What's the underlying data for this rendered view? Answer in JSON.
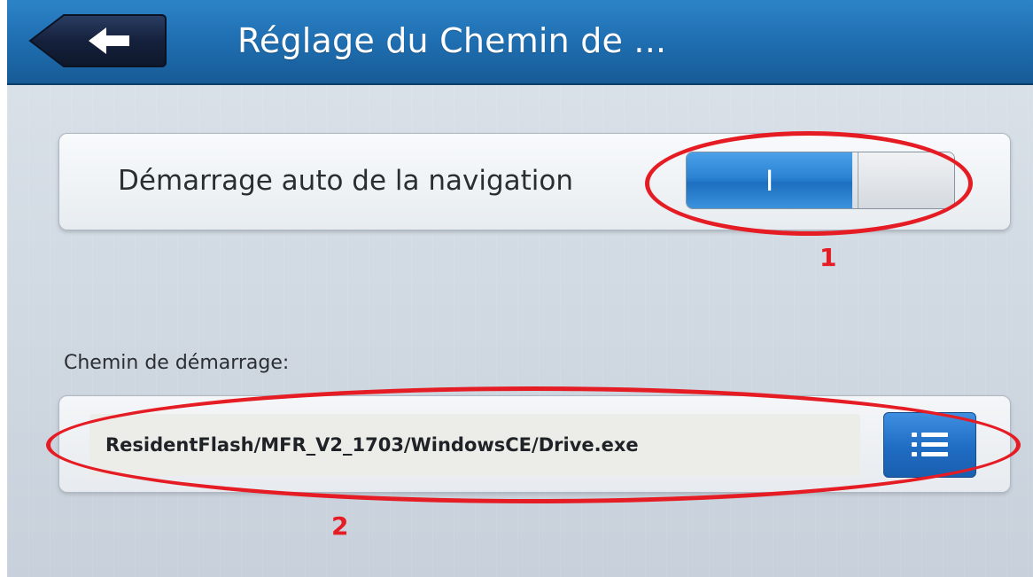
{
  "header": {
    "title": "Réglage du Chemin de ...",
    "back_icon": "arrow-left-icon",
    "colors": {
      "bar": "#1f6fb2",
      "back_button": "#1b2b4a"
    }
  },
  "auto_start": {
    "label": "Démarrage auto de la navigation",
    "toggle_on_symbol": "I",
    "toggle_state": "on",
    "toggle_fill_fraction": 0.62,
    "toggle_color": "#2b83d3"
  },
  "start_path": {
    "label": "Chemin de démarrage:",
    "value": "ResidentFlash/MFR_V2_1703/WindowsCE/Drive.exe",
    "browse_icon": "list-icon",
    "browse_color": "#1f6cc4"
  },
  "annotations": {
    "color": "#e51c23",
    "items": [
      {
        "label": "1"
      },
      {
        "label": "2"
      }
    ]
  }
}
